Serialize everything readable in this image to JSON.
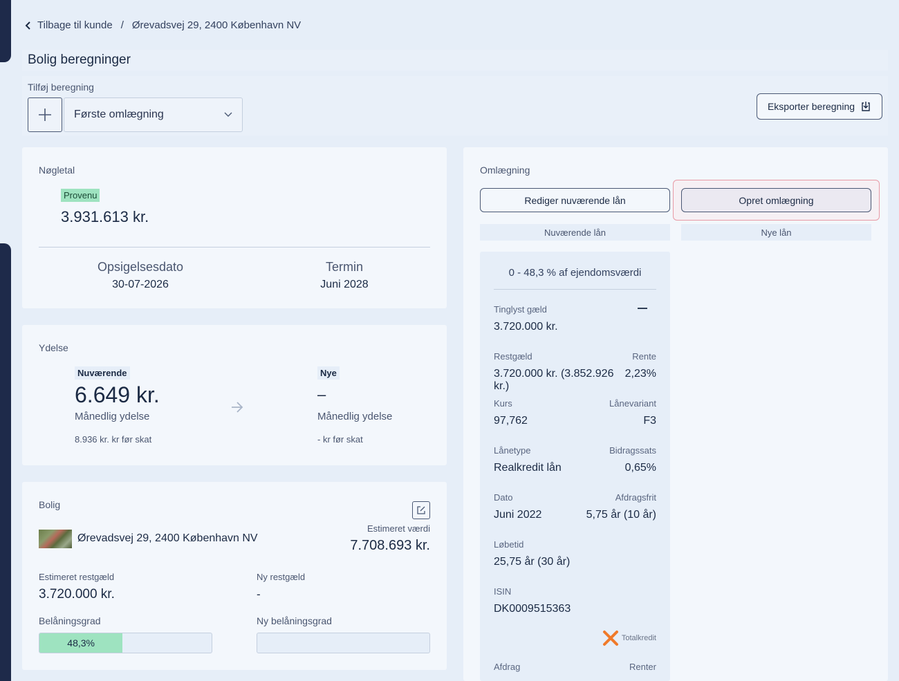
{
  "breadcrumb": {
    "back_label": "Tilbage til kunde",
    "separator": "/",
    "address": "Ørevadsvej 29, 2400 København NV"
  },
  "page_title": "Bolig beregninger",
  "add_calc": {
    "label": "Tilføj beregning",
    "selected": "Første omlægning"
  },
  "export_label": "Eksporter beregning",
  "noegletal": {
    "title": "Nøgletal",
    "provenu_label": "Provenu",
    "provenu_value": "3.931.613 kr.",
    "opsigelse_label": "Opsigelsesdato",
    "opsigelse_value": "30-07-2026",
    "termin_label": "Termin",
    "termin_value": "Juni 2028"
  },
  "ydelse": {
    "title": "Ydelse",
    "current_badge": "Nuværende",
    "current_value": "6.649 kr.",
    "current_sub": "Månedlig ydelse",
    "current_pretax": "8.936 kr. kr før skat",
    "new_badge": "Nye",
    "new_value": "–",
    "new_sub": "Månedlig ydelse",
    "new_pretax": "- kr før skat"
  },
  "bolig": {
    "title": "Bolig",
    "address": "Ørevadsvej 29, 2400 København NV",
    "est_value_label": "Estimeret værdi",
    "est_value": "7.708.693 kr.",
    "est_rest_label": "Estimeret restgæld",
    "est_rest": "3.720.000 kr.",
    "new_rest_label": "Ny restgæld",
    "new_rest": "-",
    "ltv_label": "Belåningsgrad",
    "ltv_text": "48,3%",
    "ltv_fraction": 0.483,
    "new_ltv_label": "Ny belåningsgrad"
  },
  "omlaegning": {
    "title": "Omlægning",
    "edit_btn": "Rediger nuværende lån",
    "create_btn": "Opret omlægning",
    "tab_current": "Nuværende lån",
    "tab_new": "Nye lån",
    "loan": {
      "range": "0 - 48,3 % af ejendomsværdi",
      "tinglyst_label": "Tinglyst gæld",
      "tinglyst_value": "3.720.000 kr.",
      "restgaeld_label": "Restgæld",
      "restgaeld_value": "3.720.000 kr. (3.852.926 kr.)",
      "rente_label": "Rente",
      "rente_value": "2,23%",
      "kurs_label": "Kurs",
      "kurs_value": "97,762",
      "variant_label": "Lånevariant",
      "variant_value": "F3",
      "type_label": "Lånetype",
      "type_value": "Realkredit lån",
      "bidrag_label": "Bidragssats",
      "bidrag_value": "0,65%",
      "dato_label": "Dato",
      "dato_value": "Juni 2022",
      "afdragsfrit_label": "Afdragsfrit",
      "afdragsfrit_value": "5,75 år (10 år)",
      "loebetid_label": "Løbetid",
      "loebetid_value": "25,75 år (30 år)",
      "isin_label": "ISIN",
      "isin_value": "DK0009515363",
      "lender": "Totalkredit",
      "afdrag_label": "Afdrag",
      "renter_label": "Renter"
    }
  },
  "colors": {
    "accent_green": "#9ee3c0",
    "highlight_red": "#e89aa5",
    "nav_dark": "#1e2a4a",
    "lender_orange": "#f07a2a"
  }
}
